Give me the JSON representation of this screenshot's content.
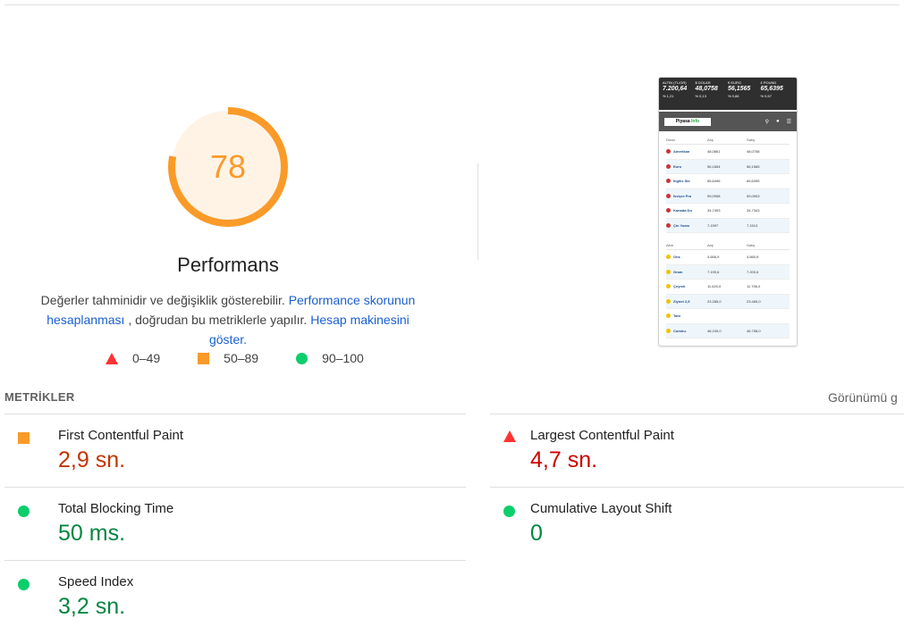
{
  "gauge": {
    "score": "78",
    "score_fraction": 0.78,
    "color": "#fa9a28",
    "bg": "#fff3e6"
  },
  "category_title": "Performans",
  "description": {
    "part1": "Değerler tahminidir ve değişiklik gösterebilir.",
    "link1": "Performance skorunun hesaplanması",
    "part2": ", doğrudan bu metriklerle yapılır.",
    "link2": "Hesap makinesini göster."
  },
  "legend": [
    {
      "label": "0–49",
      "shape": "triangle",
      "color": "#ff3333"
    },
    {
      "label": "50–89",
      "shape": "square",
      "color": "#fa9a28"
    },
    {
      "label": "90–100",
      "shape": "circle",
      "color": "#0cce6b"
    }
  ],
  "thumbnail": {
    "tickers": [
      {
        "name": "ALTIN (TL/GR)",
        "value": "7.200,64",
        "change": "% 1,21"
      },
      {
        "name": "$ DOLAR",
        "value": "48,0758",
        "change": "% 0,13"
      },
      {
        "name": "€ EURO",
        "value": "56,1565",
        "change": "% 0,86"
      },
      {
        "name": "£ POUND",
        "value": "65,6395",
        "change": "% 0,67"
      }
    ],
    "logo_a": "Piyasa",
    "logo_b": "Info",
    "currency_headers": [
      "Döviz",
      "Alış",
      "Satış"
    ],
    "currency_rows": [
      {
        "name": "Amerikan",
        "buy": "48,0861",
        "sell": "48,0758"
      },
      {
        "name": "Euro",
        "buy": "56,1654",
        "sell": "56,1565"
      },
      {
        "name": "İngiliz Ste",
        "buy": "65,6496",
        "sell": "65,6395"
      },
      {
        "name": "İsviçre Fra",
        "buy": "59,0958",
        "sell": "59,0903"
      },
      {
        "name": "Kanada Do",
        "buy": "34,7493",
        "sell": "34,7343"
      },
      {
        "name": "Çin Yuanı",
        "buy": "7,1597",
        "sell": "7,1513"
      }
    ],
    "gold_headers": [
      "Altın",
      "Alış",
      "Satış"
    ],
    "gold_rows": [
      {
        "name": "Ons",
        "buy": "4.656,9",
        "sell": "4.660,6"
      },
      {
        "name": "Gram",
        "buy": "7.199,6",
        "sell": "7.200,6"
      },
      {
        "name": "Çeyrek",
        "buy": "11.620,0",
        "sell": "11.756,0"
      },
      {
        "name": "Ziynet 2,5",
        "buy": "23.285,0",
        "sell": "23.465,0"
      },
      {
        "name": "Tam",
        "buy": "",
        "sell": ""
      },
      {
        "name": "Cumhu.",
        "buy": "46.249,0",
        "sell": "46.758,0"
      }
    ]
  },
  "metrics_title": "METRİKLER",
  "view_toggle": "Görünümü g",
  "metrics": [
    {
      "name": "First Contentful Paint",
      "value": "2,9 sn.",
      "rating": "average"
    },
    {
      "name": "Largest Contentful Paint",
      "value": "4,7 sn.",
      "rating": "fail"
    },
    {
      "name": "Total Blocking Time",
      "value": "50 ms.",
      "rating": "pass"
    },
    {
      "name": "Cumulative Layout Shift",
      "value": "0",
      "rating": "pass"
    },
    {
      "name": "Speed Index",
      "value": "3,2 sn.",
      "rating": "pass"
    }
  ]
}
